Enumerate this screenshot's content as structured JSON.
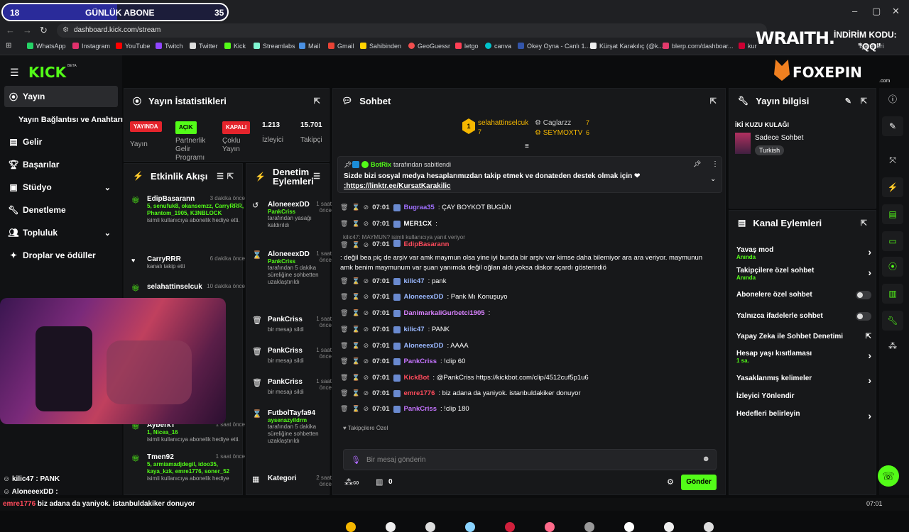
{
  "browser": {
    "url": "dashboard.kick.com/stream",
    "bookmarks": [
      "WhatsApp",
      "Instagram",
      "YouTube",
      "Twitch",
      "Twitter",
      "Kick",
      "Streamlabs",
      "Mail",
      "Gmail",
      "Sahibinden",
      "GeoGuessr",
      "letgo",
      "canva",
      "Okey Oyna - Canlı 1...",
      "Kürşat Karakılıç (@k...",
      "blerp.com/dashboar...",
      "kur",
      "İşaretleri"
    ]
  },
  "overlay": {
    "sub_count": "18",
    "sub_label": "GÜNLÜK ABONE",
    "sub_goal": "35",
    "sub_progress": 0.51,
    "wraith": "WRAITH.",
    "discount_label": "İNDİRİM KODU:",
    "discount_code": "\"QQ\"",
    "foxepin": "FOXEPIN",
    "foxepin_sub": ".com",
    "bottom_chat": [
      {
        "user": "kilic47",
        "text": " : PANK"
      },
      {
        "user": "AloneeexDD",
        "text": " : "
      },
      {
        "user": "emre1776",
        "text": " biz adana da yaniyok. istanbuldakiker donuyor"
      }
    ]
  },
  "nav": {
    "brand": "KICK",
    "brand_sup": "BETA",
    "items": [
      {
        "label": "Yayın",
        "icon": "broadcast-icon"
      },
      {
        "label": "Yayın Bağlantısı ve Anahtarı",
        "icon": ""
      },
      {
        "label": "Gelir",
        "icon": "revenue-icon"
      },
      {
        "label": "Başarılar",
        "icon": "trophy-icon"
      },
      {
        "label": "Stüdyo",
        "icon": "studio-icon"
      },
      {
        "label": "Denetleme",
        "icon": "wrench-icon"
      },
      {
        "label": "Topluluk",
        "icon": "community-icon"
      },
      {
        "label": "Droplar ve ödüller",
        "icon": "drops-icon"
      }
    ]
  },
  "stats": {
    "title": "Yayın İstatistikleri",
    "badges": [
      {
        "badge": "YAYINDA",
        "label": "Yayın",
        "color": "#e5242c"
      },
      {
        "badge": "AÇIK",
        "label": "Partnerlik Gelir Programı",
        "color": "#53fc18"
      },
      {
        "badge": "KAPALI",
        "label": "Çoklu Yayın",
        "color": "#e5242c"
      }
    ],
    "viewers_value": "1.213",
    "viewers_label": "İzleyici",
    "followers_value": "15.701",
    "followers_label": "Takipçi"
  },
  "activity": {
    "title": "Etkinlik Akışı",
    "items": [
      {
        "name": "EdipBasarann",
        "time": "3 dakika önce",
        "green": "5, senufuk8, okansemzz, CarryRRR, Phantom_1905, K3NBLOCK",
        "desc": "isimli kullanıcıya abonelik hediye etti."
      },
      {
        "name": "CarryRRR",
        "time": "6 dakika önce",
        "green": "",
        "desc": "kanalı takip etti"
      },
      {
        "name": "selahattinselcuk",
        "time": "10 dakika önce",
        "green": "",
        "desc": ""
      },
      {
        "name": "AyberkT",
        "time": "1 saat önce",
        "green": "1, Nicea_16",
        "desc": "isimli kullanıcıya abonelik hediye etti."
      },
      {
        "name": "Tmen92",
        "time": "1 saat önce",
        "green": "5, armiamadjdegil, idoo35, kaya_kzk, emre1776, soner_52",
        "desc": "isimli kullanıcıya abonelik hediye"
      }
    ]
  },
  "moderation": {
    "title": "Denetim Eylemleri",
    "items": [
      {
        "name": "AloneeexDD",
        "time": "1 saat önce",
        "green": "PankCriss",
        "desc": "tarafından yasağı kaldırıldı"
      },
      {
        "name": "AloneeexDD",
        "time": "1 saat önce",
        "green": "PankCriss",
        "desc": "tarafından 5 dakika süreliğine sohbetten uzaklaştırıldı"
      },
      {
        "name": "PankCriss",
        "time": "1 saat önce",
        "green": "",
        "desc": "bir mesajı sildi"
      },
      {
        "name": "PankCriss",
        "time": "1 saat önce",
        "green": "",
        "desc": "bir mesajı sildi"
      },
      {
        "name": "PankCriss",
        "time": "1 saat önce",
        "green": "",
        "desc": "bir mesajı sildi"
      },
      {
        "name": "FutbolTayfa94",
        "time": "1 saat önce",
        "green": "aysenazyildrm",
        "desc": "tarafından 5 dakika süreliğine sohbetten uzaklaştırıldı"
      },
      {
        "name": "Kategori",
        "time": "2 saat önce",
        "green": "",
        "desc": ""
      }
    ]
  },
  "chat": {
    "title": "Sohbet",
    "top_gifters": [
      {
        "rank": "1",
        "name": "selahattinselcuk",
        "count": "7"
      },
      {
        "rank": "",
        "name": "Caglarzz",
        "count": "7"
      },
      {
        "rank": "",
        "name": "SEYMOXTV",
        "count": "6"
      }
    ],
    "pinned_by": "BotRix",
    "pinned_suffix": "tarafından sabitlendi",
    "pinned_text": "Sizde bizi sosyal medya hesaplarımızdan takip etmek ve donateden destek olmak için ❤",
    "pinned_link": ":https://linktr.ee/KursatKarakilic",
    "reply_note": "kilic47: MAYMUN? isimli kullanıcıya yanıt veriyor",
    "messages": [
      {
        "time": "07:01",
        "user": "Bugraa35",
        "color": "#a070ff",
        "text": ": ÇAY BOYKOT BUGÜN"
      },
      {
        "time": "07:01",
        "user": "MER1CX",
        "color": "#ffffff",
        "text": ":"
      },
      {
        "time": "07:01",
        "user": "EdipBasarann",
        "color": "#ff4b5c",
        "text": ": değil bea piç de arşiv var amk maymun olsa yine iyi bunda bir arşiv var kimse daha bilemiyor ara ara veriyor. maymunun amk benim maymunum var şuan yanımda değil oğlan aldı yoksa diskor açardı gösterirdiö"
      },
      {
        "time": "07:01",
        "user": "kilic47",
        "color": "#9ab8ff",
        "text": ": pank"
      },
      {
        "time": "07:01",
        "user": "AloneeexDD",
        "color": "#9ab8ff",
        "text": ": Pank Mı Konuşuyo"
      },
      {
        "time": "07:01",
        "user": "DanimarkaliGurbetci1905",
        "color": "#d982ff",
        "text": ":"
      },
      {
        "time": "07:01",
        "user": "kilic47",
        "color": "#9ab8ff",
        "text": ": PANK"
      },
      {
        "time": "07:01",
        "user": "AloneeexDD",
        "color": "#9ab8ff",
        "text": ": AAAA"
      },
      {
        "time": "07:01",
        "user": "PankCriss",
        "color": "#c574ff",
        "text": ": !clip 60"
      },
      {
        "time": "07:01",
        "user": "KickBot",
        "color": "#ff4b5c",
        "text": ": @PankCriss https://kickbot.com/clip/4512cuf5p1u6"
      },
      {
        "time": "07:01",
        "user": "emre1776",
        "color": "#ff4b5c",
        "text": ": biz adana da yaniyok. istanbuldakiker donuyor"
      },
      {
        "time": "07:01",
        "user": "PankCriss",
        "color": "#c574ff",
        "text": ": !clip 180"
      }
    ],
    "followers_only": "Takipçilere Özel",
    "input_placeholder": "Bir mesaj gönderin",
    "points": "0",
    "send_label": "Gönder"
  },
  "stream_info": {
    "title": "Yayın bilgisi",
    "stream_title": "İKİ KUZU KULAĞI",
    "category": "Sadece Sohbet",
    "tag": "Turkish"
  },
  "channel_actions": {
    "title": "Kanal Eylemleri",
    "items": [
      {
        "label": "Yavaş mod",
        "sub": "Anında",
        "control": "arrow"
      },
      {
        "label": "Takipçilere özel sohbet",
        "sub": "Anında",
        "control": "arrow"
      },
      {
        "label": "Abonelere özel sohbet",
        "sub": "",
        "control": "toggle"
      },
      {
        "label": "Yalnızca ifadelerle sohbet",
        "sub": "",
        "control": "toggle"
      },
      {
        "label": "Yapay Zeka ile Sohbet Denetimi",
        "sub": "",
        "control": "external"
      },
      {
        "label": "Hesap yaşı kısıtlaması",
        "sub": "1 sa.",
        "control": "arrow"
      },
      {
        "label": "Yasaklanmış kelimeler",
        "sub": "",
        "control": "arrow"
      },
      {
        "label": "İzleyici Yönlendir",
        "sub": "",
        "control": "none"
      },
      {
        "label": "Hedefleri belirleyin",
        "sub": "",
        "control": "arrow"
      }
    ]
  },
  "taskbar": {
    "time": "07:01"
  }
}
